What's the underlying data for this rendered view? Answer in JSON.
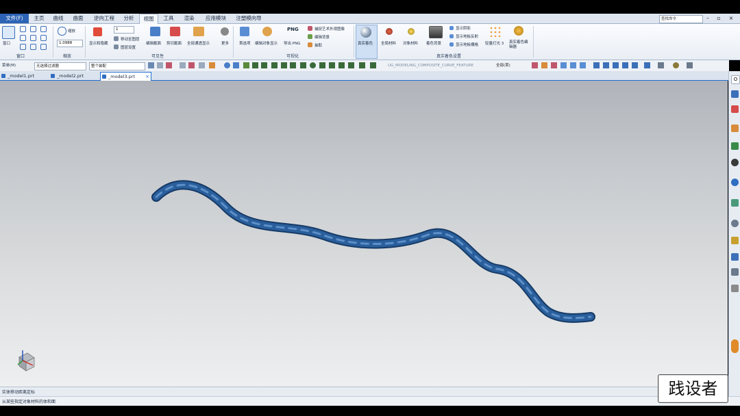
{
  "menu": {
    "file_tab": "文件(F)",
    "tabs": [
      "主页",
      "曲线",
      "曲面",
      "逆向工程",
      "分析",
      "视图",
      "工具",
      "渲染",
      "应用模块",
      "注塑模向导"
    ],
    "active_tab": "视图",
    "command_search_placeholder": "查找命令"
  },
  "ribbon": {
    "window_group": {
      "label": "窗口",
      "button": "窗口"
    },
    "zoom_group": {
      "label": "缩放",
      "zoom_label": "缩放",
      "zoom_value": "1.0988"
    },
    "visibility_group": {
      "label": "可见性",
      "layer_value": "1",
      "show_hide": "显示和隐藏",
      "move_to_layer": "移动至图层",
      "layer_settings": "图层设置",
      "edit_section": "编辑截面",
      "clip_section": "剪切截面",
      "full_section": "全部通透显示",
      "more": "更多"
    },
    "visualization_group": {
      "label": "可视化",
      "backdrop": "首选项",
      "edit_object_display": "编辑对象显示",
      "export_png": "导出 PNG",
      "png_label": "PNG",
      "capture_image": "捕捉艺术外观图像",
      "edit_background": "编辑背景",
      "rod": "抽取"
    },
    "true_shading_group": {
      "label": "真实着色设置",
      "true_shading": "真实着色",
      "global_material": "全局材料",
      "object_material": "对象材料",
      "background": "着色背景",
      "show_shadows": "显示阴影",
      "show_reflections": "显示地板反射",
      "show_floor_grid": "显示地板栅格",
      "lighting": "轻量灯光 3",
      "shading_editor": "真实着色编辑器"
    }
  },
  "filterbar": {
    "menu": "菜单(M)",
    "type_filter": "无选择过滤器",
    "scope": "整个装配",
    "feature_hint": "UG_MODELING_COMPOSITE_CURVE_FEATURE",
    "view_dropdown": "全部(草)"
  },
  "doc_tabs": [
    "_model1.prt",
    "_model2.prt",
    "_model3.prt"
  ],
  "active_doc": "_model3.prt",
  "status": {
    "line1": "实体移动距离定标",
    "line2": "从某些指定对象材料的体和面"
  },
  "watermark": "践设者",
  "colors": {
    "accent": "#2c63b5",
    "tube": "#1f4f87",
    "viewport_top": "#b0b4ba",
    "viewport_bottom": "#eeeff0"
  }
}
